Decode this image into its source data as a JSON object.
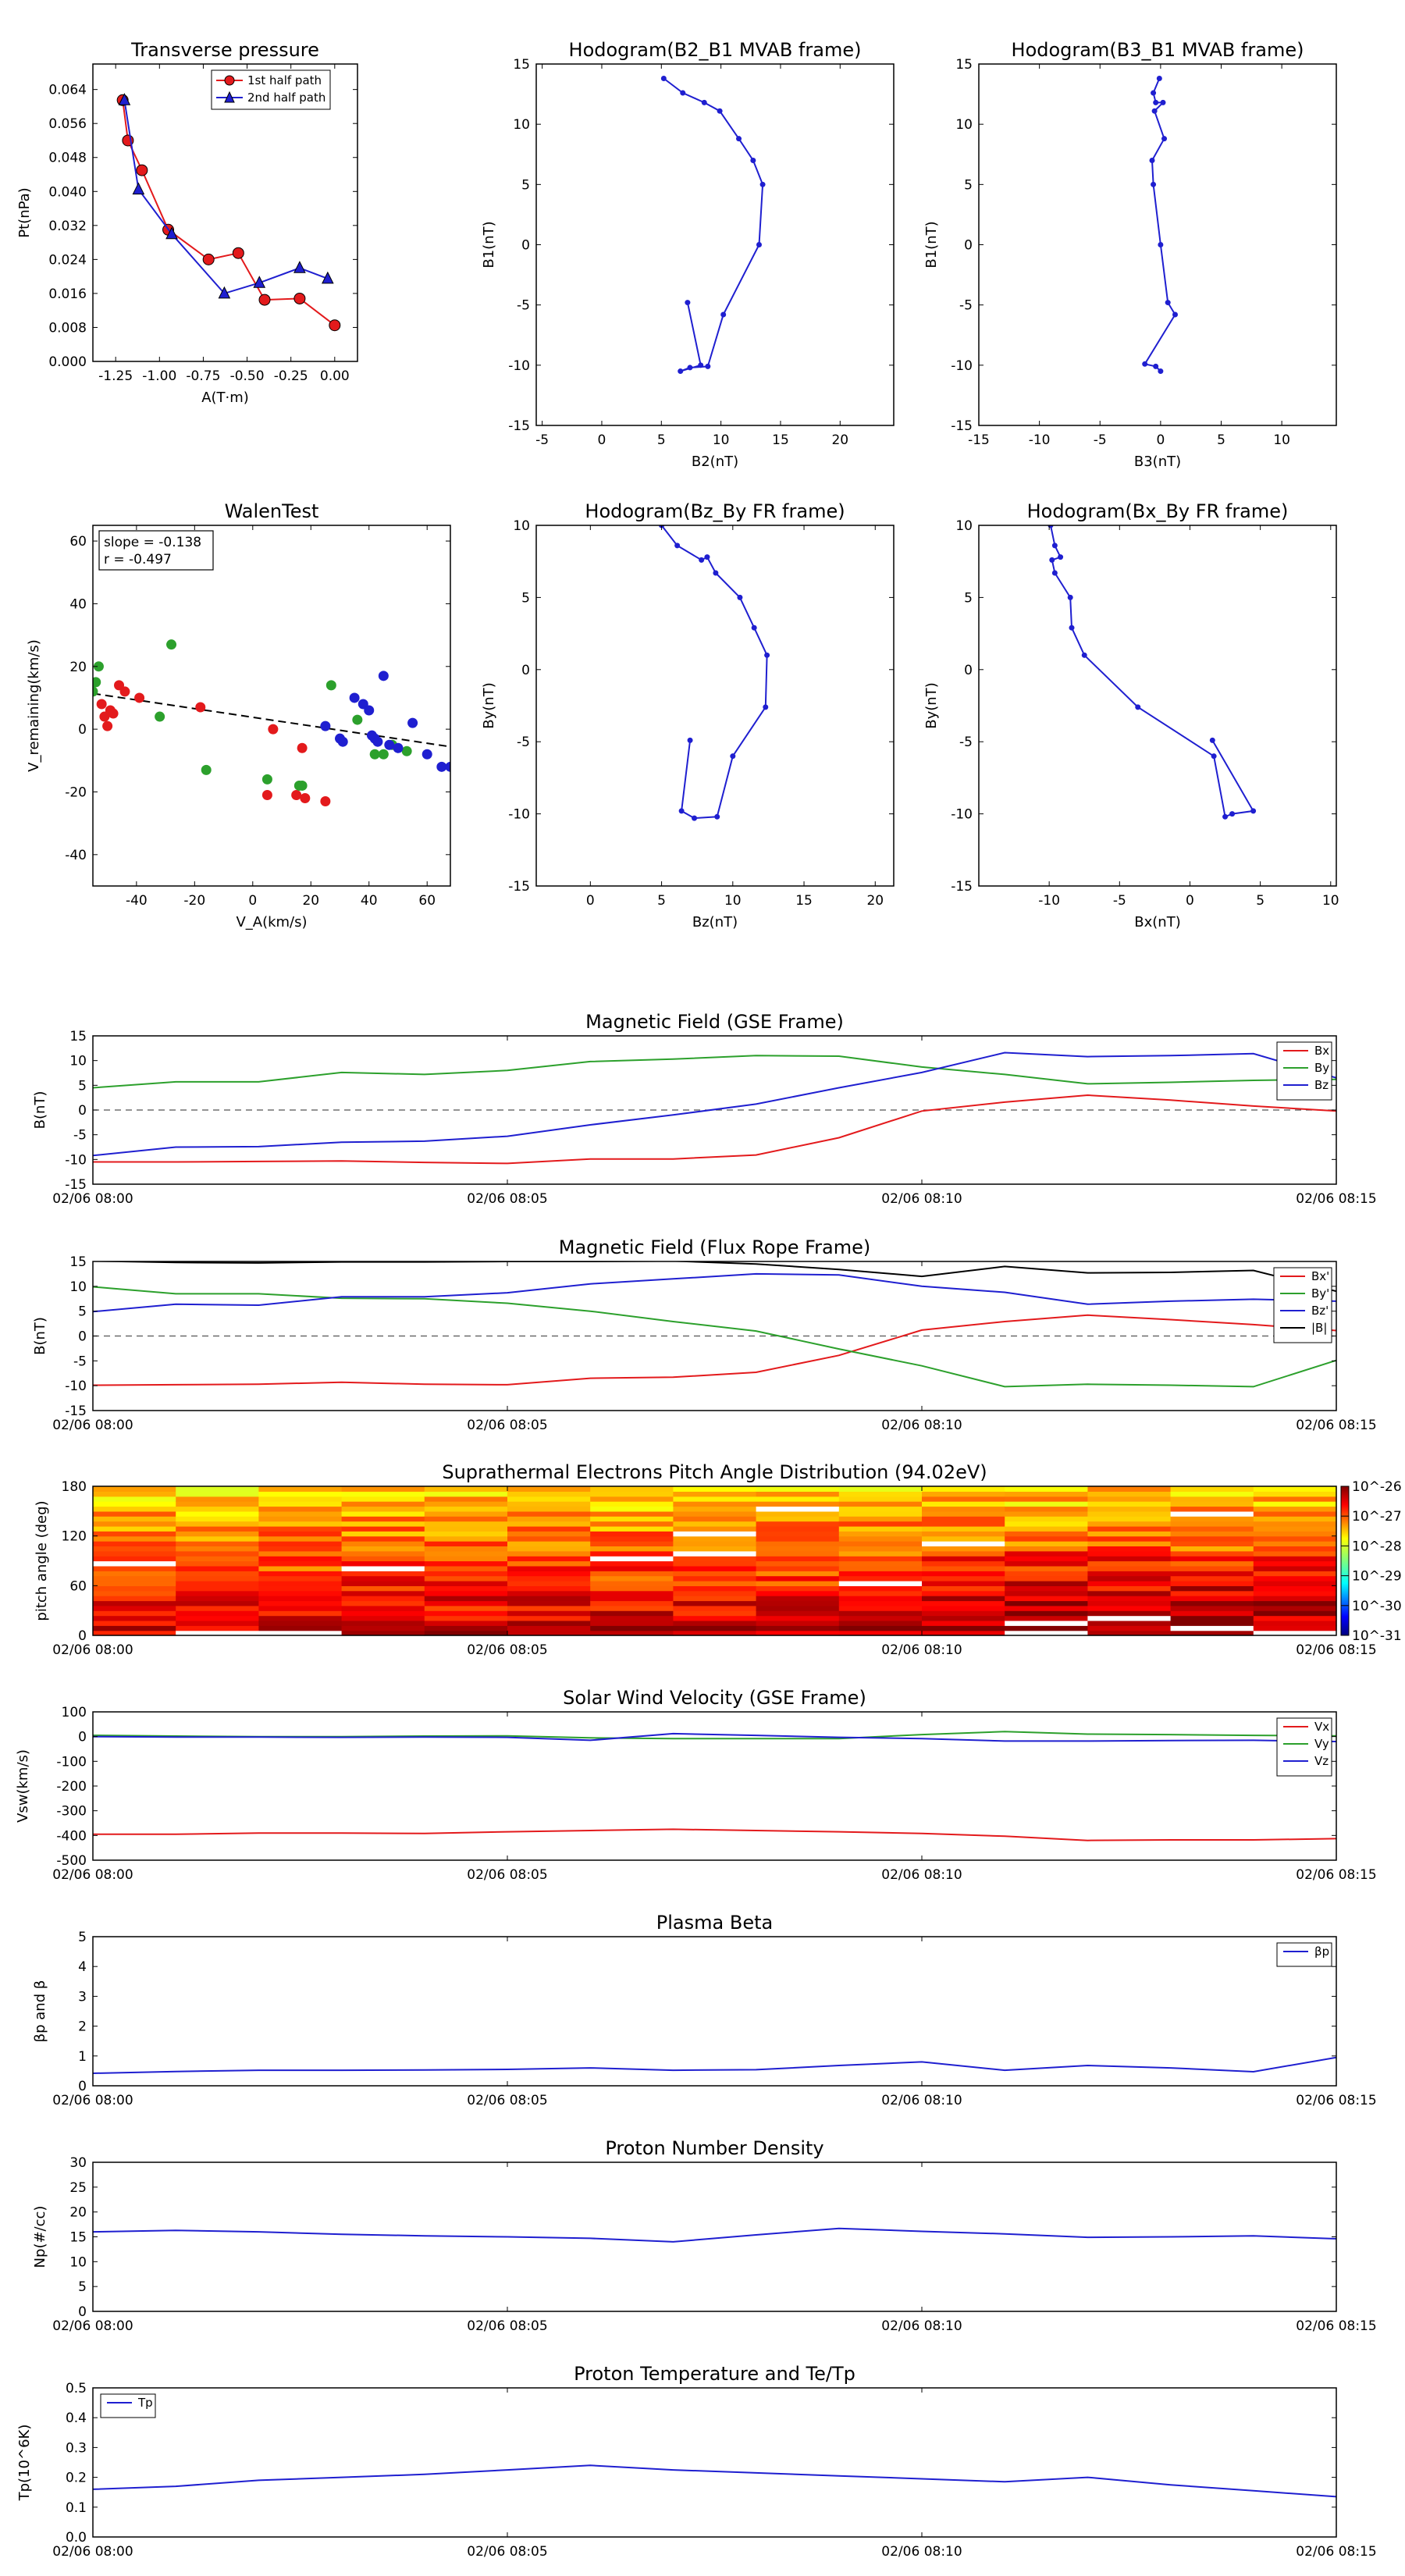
{
  "chart_data": [
    {
      "id": "transverse",
      "type": "line",
      "title": "Transverse pressure",
      "xlabel": "A(T·m)",
      "ylabel": "Pt(nPa)",
      "xlim": [
        -1.38,
        0.13
      ],
      "ylim": [
        0,
        0.07
      ],
      "xticks": [
        -1.25,
        -1.0,
        -0.75,
        -0.5,
        -0.25,
        0.0
      ],
      "xtick_labels": [
        "-1.25",
        "-1.00",
        "-0.75",
        "-0.50",
        "-0.25",
        "0.00"
      ],
      "yticks": [
        0,
        0.008,
        0.016,
        0.024,
        0.032,
        0.04,
        0.048,
        0.056,
        0.064
      ],
      "ytick_labels": [
        "0.000",
        "0.008",
        "0.016",
        "0.024",
        "0.032",
        "0.040",
        "0.048",
        "0.056",
        "0.064"
      ],
      "legend_position": "top-center",
      "series": [
        {
          "name": "1st half path",
          "color": "#e31a1c",
          "marker": "circle",
          "x": [
            -1.21,
            -1.18,
            -1.1,
            -0.95,
            -0.72,
            -0.55,
            -0.4,
            -0.2,
            0.0
          ],
          "y": [
            0.0615,
            0.052,
            0.045,
            0.031,
            0.024,
            0.0255,
            0.0145,
            0.0148,
            0.0085
          ]
        },
        {
          "name": "2nd half path",
          "color": "#1f1fd0",
          "marker": "triangle",
          "x": [
            -1.2,
            -1.12,
            -0.93,
            -0.63,
            -0.43,
            -0.2,
            -0.04
          ],
          "y": [
            0.0615,
            0.0405,
            0.03,
            0.016,
            0.0185,
            0.022,
            0.0195
          ]
        }
      ]
    },
    {
      "id": "hodo_b2b1",
      "type": "line",
      "title": "Hodogram(B2_B1 MVAB frame)",
      "xlabel": "B2(nT)",
      "ylabel": "B1(nT)",
      "xlim": [
        -5.5,
        24.5
      ],
      "ylim": [
        -15,
        15
      ],
      "xticks": [
        -5,
        0,
        5,
        10,
        15,
        20
      ],
      "yticks": [
        -15,
        -10,
        -5,
        0,
        5,
        10,
        15
      ],
      "series": [
        {
          "name": "",
          "color": "#1f1fd0",
          "x": [
            5.2,
            6.8,
            8.6,
            9.9,
            11.5,
            12.7,
            13.5,
            13.2,
            10.2,
            8.9,
            7.4,
            6.6,
            8.3,
            7.2
          ],
          "y": [
            13.8,
            12.6,
            11.8,
            11.1,
            8.8,
            7.0,
            5.0,
            0.0,
            -5.8,
            -10.1,
            -10.2,
            -10.5,
            -10.0,
            -4.8
          ]
        }
      ]
    },
    {
      "id": "hodo_b3b1",
      "type": "line",
      "title": "Hodogram(B3_B1 MVAB frame)",
      "xlabel": "B3(nT)",
      "ylabel": "B1(nT)",
      "xlim": [
        -15,
        14.5
      ],
      "ylim": [
        -15,
        15
      ],
      "xticks": [
        -15,
        -10,
        -5,
        0,
        5,
        10
      ],
      "yticks": [
        -15,
        -10,
        -5,
        0,
        5,
        10,
        15
      ],
      "series": [
        {
          "name": "",
          "color": "#1f1fd0",
          "x": [
            -0.1,
            -0.6,
            -0.4,
            0.2,
            -0.5,
            0.3,
            -0.7,
            -0.6,
            0.0,
            0.6,
            1.2,
            -1.3,
            -0.4,
            0.0
          ],
          "y": [
            13.8,
            12.6,
            11.8,
            11.8,
            11.1,
            8.8,
            7.0,
            5.0,
            0.0,
            -4.8,
            -5.8,
            -9.9,
            -10.1,
            -10.5
          ]
        }
      ]
    },
    {
      "id": "walen",
      "type": "scatter",
      "title": "WalenTest",
      "xlabel": "V_A(km/s)",
      "ylabel": "V_remaining(km/s)",
      "xlim": [
        -55,
        68
      ],
      "ylim": [
        -50,
        65
      ],
      "xticks": [
        -40,
        -20,
        0,
        20,
        40,
        60
      ],
      "yticks": [
        -40,
        -20,
        0,
        20,
        40,
        60
      ],
      "annotations": [
        "slope = -0.138",
        "r = -0.497"
      ],
      "fit_line": {
        "slope": -0.138,
        "intercept": 3.8,
        "x_range": [
          -55,
          68
        ],
        "color": "#000000"
      },
      "series": [
        {
          "name": "",
          "color": "#e31a1c",
          "x": [
            -52,
            -51,
            -50,
            -49,
            -48,
            -46,
            -44,
            -39,
            -18,
            7,
            5,
            15,
            17,
            18,
            25
          ],
          "y": [
            8,
            4,
            1,
            6,
            5,
            14,
            12,
            10,
            7,
            0,
            -21,
            -21,
            -6,
            -22,
            -23
          ]
        },
        {
          "name": "",
          "color": "#2ca02c",
          "x": [
            -55,
            -54,
            -53,
            -32,
            -28,
            -16,
            5,
            16,
            17,
            27,
            36,
            42,
            45,
            48,
            53
          ],
          "y": [
            12,
            15,
            20,
            4,
            27,
            -13,
            -16,
            -18,
            -18,
            14,
            3,
            -8,
            -8,
            -5,
            -7
          ]
        },
        {
          "name": "",
          "color": "#1f1fd0",
          "x": [
            25,
            30,
            31,
            35,
            38,
            40,
            41,
            42,
            43,
            45,
            47,
            50,
            55,
            60,
            65,
            68
          ],
          "y": [
            1,
            -3,
            -4,
            10,
            8,
            6,
            -2,
            -3,
            -4,
            17,
            -5,
            -6,
            2,
            -8,
            -12,
            -12
          ]
        }
      ]
    },
    {
      "id": "hodo_bzby",
      "type": "line",
      "title": "Hodogram(Bz_By FR frame)",
      "xlabel": "Bz(nT)",
      "ylabel": "By(nT)",
      "xlim": [
        -3.8,
        21.3
      ],
      "ylim": [
        -15,
        10
      ],
      "xticks": [
        0,
        5,
        10,
        15,
        20
      ],
      "yticks": [
        -15,
        -10,
        -5,
        0,
        5,
        10
      ],
      "series": [
        {
          "name": "",
          "color": "#1f1fd0",
          "x": [
            5.0,
            6.1,
            7.8,
            8.2,
            8.8,
            10.5,
            11.5,
            12.4,
            12.3,
            10.0,
            8.9,
            7.3,
            6.4,
            7.0
          ],
          "y": [
            10.0,
            8.6,
            7.6,
            7.8,
            6.7,
            5.0,
            2.9,
            1.0,
            -2.6,
            -6.0,
            -10.2,
            -10.3,
            -9.8,
            -4.9
          ]
        }
      ]
    },
    {
      "id": "hodo_bxby",
      "type": "line",
      "title": "Hodogram(Bx_By FR frame)",
      "xlabel": "Bx(nT)",
      "ylabel": "By(nT)",
      "xlim": [
        -15,
        10.4
      ],
      "ylim": [
        -15,
        10
      ],
      "xticks": [
        -10,
        -5,
        0,
        5,
        10
      ],
      "yticks": [
        -15,
        -10,
        -5,
        0,
        5,
        10
      ],
      "series": [
        {
          "name": "",
          "color": "#1f1fd0",
          "x": [
            -9.9,
            -9.6,
            -9.2,
            -9.8,
            -9.6,
            -8.5,
            -8.4,
            -7.5,
            -3.7,
            1.7,
            2.5,
            3.0,
            4.5,
            1.6
          ],
          "y": [
            10.0,
            8.6,
            7.8,
            7.6,
            6.7,
            5.0,
            2.9,
            1.0,
            -2.6,
            -6.0,
            -10.2,
            -10.0,
            -9.8,
            -4.9
          ]
        }
      ]
    },
    {
      "id": "mag_gse",
      "type": "line",
      "title": "Magnetic Field (GSE Frame)",
      "ylabel": "B(nT)",
      "xlim": [
        0,
        15
      ],
      "x_unit": "minutes after 02/06 08:00",
      "ylim": [
        -15,
        15
      ],
      "yticks": [
        -15,
        -10,
        -5,
        0,
        5,
        10,
        15
      ],
      "xtick_labels": [
        "02/06 08:00",
        "02/06 08:05",
        "02/06 08:10",
        "02/06 08:15"
      ],
      "legend_position": "top-right",
      "zero_line": true,
      "x": [
        0,
        1,
        2,
        3,
        4,
        5,
        6,
        7,
        8,
        9,
        10,
        11,
        12,
        13,
        14,
        15
      ],
      "series": [
        {
          "name": "Bx",
          "color": "#e31a1c",
          "values": [
            -10.5,
            -10.5,
            -10.4,
            -10.3,
            -10.6,
            -10.8,
            -9.9,
            -9.9,
            -9.1,
            -5.6,
            -0.2,
            1.6,
            3.0,
            2.0,
            0.8,
            -0.2
          ]
        },
        {
          "name": "By",
          "color": "#2ca02c",
          "values": [
            4.5,
            5.7,
            5.7,
            7.6,
            7.2,
            8.0,
            9.8,
            10.3,
            11.0,
            10.9,
            8.7,
            7.2,
            5.3,
            5.6,
            6.0,
            6.2
          ]
        },
        {
          "name": "Bz",
          "color": "#1f1fd0",
          "values": [
            -9.2,
            -7.5,
            -7.4,
            -6.5,
            -6.3,
            -5.3,
            -3.0,
            -1.0,
            1.2,
            4.5,
            7.6,
            11.6,
            10.8,
            11.0,
            11.4,
            6.5
          ]
        }
      ]
    },
    {
      "id": "mag_fr",
      "type": "line",
      "title": "Magnetic Field (Flux Rope Frame)",
      "ylabel": "B(nT)",
      "xlim": [
        0,
        15
      ],
      "x_unit": "minutes after 02/06 08:00",
      "ylim": [
        -15,
        15
      ],
      "yticks": [
        -15,
        -10,
        -5,
        0,
        5,
        10,
        15
      ],
      "xtick_labels": [
        "02/06 08:00",
        "02/06 08:05",
        "02/06 08:10",
        "02/06 08:15"
      ],
      "legend_position": "top-right",
      "zero_line": true,
      "x": [
        0,
        1,
        2,
        3,
        4,
        5,
        6,
        7,
        8,
        9,
        10,
        11,
        12,
        13,
        14,
        15
      ],
      "series": [
        {
          "name": "Bx'",
          "color": "#e31a1c",
          "values": [
            -9.9,
            -9.8,
            -9.7,
            -9.3,
            -9.7,
            -9.8,
            -8.5,
            -8.3,
            -7.3,
            -3.9,
            1.2,
            2.9,
            4.2,
            3.3,
            2.3,
            1.1
          ]
        },
        {
          "name": "By'",
          "color": "#2ca02c",
          "values": [
            9.9,
            8.5,
            8.5,
            7.6,
            7.5,
            6.6,
            5.0,
            2.9,
            1.0,
            -2.6,
            -6.0,
            -10.2,
            -9.7,
            -9.9,
            -10.2,
            -4.9
          ]
        },
        {
          "name": "Bz'",
          "color": "#1f1fd0",
          "values": [
            4.9,
            6.4,
            6.2,
            7.9,
            7.9,
            8.7,
            10.5,
            11.5,
            12.5,
            12.3,
            10.0,
            8.8,
            6.4,
            7.0,
            7.4,
            7.0
          ]
        },
        {
          "name": "|B|",
          "color": "#000000",
          "values": [
            15.1,
            14.8,
            14.7,
            14.9,
            14.9,
            15.0,
            15.0,
            15.1,
            14.5,
            13.4,
            12.0,
            14.0,
            12.7,
            12.8,
            13.2,
            9.0
          ]
        }
      ]
    },
    {
      "id": "pad",
      "type": "heatmap",
      "title": "Suprathermal Electrons Pitch Angle Distribution (94.02eV)",
      "ylabel": "pitch angle (deg)",
      "xlim": [
        0,
        15
      ],
      "ylim": [
        0,
        180
      ],
      "yticks": [
        0,
        60,
        120,
        180
      ],
      "xtick_labels": [
        "02/06 08:00",
        "02/06 08:05",
        "02/06 08:10",
        "02/06 08:15"
      ],
      "colorbar_labels": [
        "10^-26",
        "10^-27",
        "10^-28",
        "10^-29",
        "10^-30",
        "10^-31"
      ],
      "n_time_bins": 15,
      "n_angle_bins": 30,
      "log_flux_range": [
        -31,
        -26
      ]
    },
    {
      "id": "vsw",
      "type": "line",
      "title": "Solar Wind Velocity (GSE Frame)",
      "ylabel": "Vsw(km/s)",
      "xlim": [
        0,
        15
      ],
      "x_unit": "minutes after 02/06 08:00",
      "ylim": [
        -500,
        100
      ],
      "yticks": [
        -500,
        -400,
        -300,
        -200,
        -100,
        0,
        100
      ],
      "xtick_labels": [
        "02/06 08:00",
        "02/06 08:05",
        "02/06 08:10",
        "02/06 08:15"
      ],
      "legend_position": "top-right",
      "x": [
        0,
        1,
        2,
        3,
        4,
        5,
        6,
        7,
        8,
        9,
        10,
        11,
        12,
        13,
        14,
        15
      ],
      "series": [
        {
          "name": "Vx",
          "color": "#e31a1c",
          "values": [
            -395,
            -395,
            -390,
            -390,
            -392,
            -385,
            -380,
            -375,
            -380,
            -385,
            -392,
            -403,
            -420,
            -418,
            -418,
            -413
          ]
        },
        {
          "name": "Vy",
          "color": "#2ca02c",
          "values": [
            5,
            2,
            0,
            0,
            2,
            3,
            -5,
            -8,
            -8,
            -8,
            8,
            20,
            10,
            8,
            5,
            3
          ]
        },
        {
          "name": "Vz",
          "color": "#1f1fd0",
          "values": [
            0,
            -2,
            -2,
            -3,
            -2,
            -3,
            -15,
            12,
            5,
            -3,
            -8,
            -18,
            -18,
            -16,
            -15,
            -20
          ]
        }
      ]
    },
    {
      "id": "beta",
      "type": "line",
      "title": "Plasma Beta",
      "ylabel": "βp and β",
      "xlim": [
        0,
        15
      ],
      "x_unit": "minutes after 02/06 08:00",
      "ylim": [
        0,
        5
      ],
      "yticks": [
        0,
        1,
        2,
        3,
        4,
        5
      ],
      "xtick_labels": [
        "02/06 08:00",
        "02/06 08:05",
        "02/06 08:10",
        "02/06 08:15"
      ],
      "legend_position": "top-right",
      "x": [
        0,
        1,
        2,
        3,
        4,
        5,
        6,
        7,
        8,
        9,
        10,
        11,
        12,
        13,
        14,
        15
      ],
      "series": [
        {
          "name": "βp",
          "color": "#1f1fd0",
          "values": [
            0.42,
            0.48,
            0.52,
            0.52,
            0.53,
            0.55,
            0.6,
            0.52,
            0.54,
            0.68,
            0.8,
            0.52,
            0.68,
            0.6,
            0.47,
            0.95
          ]
        }
      ]
    },
    {
      "id": "density",
      "type": "line",
      "title": "Proton Number Density",
      "ylabel": "Np(#/cc)",
      "xlim": [
        0,
        15
      ],
      "x_unit": "minutes after 02/06 08:00",
      "ylim": [
        0,
        30
      ],
      "yticks": [
        0,
        5,
        10,
        15,
        20,
        25,
        30
      ],
      "xtick_labels": [
        "02/06 08:00",
        "02/06 08:05",
        "02/06 08:10",
        "02/06 08:15"
      ],
      "x": [
        0,
        1,
        2,
        3,
        4,
        5,
        6,
        7,
        8,
        9,
        10,
        11,
        12,
        13,
        14,
        15
      ],
      "series": [
        {
          "name": "",
          "color": "#1f1fd0",
          "values": [
            16.0,
            16.3,
            16.0,
            15.5,
            15.2,
            15.0,
            14.7,
            14.0,
            15.4,
            16.7,
            16.1,
            15.6,
            14.9,
            15.0,
            15.2,
            14.6
          ]
        }
      ]
    },
    {
      "id": "temperature",
      "type": "line",
      "title": "Proton Temperature and Te/Tp",
      "ylabel": "Tp(10^6K)",
      "xlim": [
        0,
        15
      ],
      "x_unit": "minutes after 02/06 08:00",
      "ylim": [
        0,
        0.5
      ],
      "yticks": [
        0,
        0.1,
        0.2,
        0.3,
        0.4,
        0.5
      ],
      "ytick_labels": [
        "0.0",
        "0.1",
        "0.2",
        "0.3",
        "0.4",
        "0.5"
      ],
      "xtick_labels": [
        "02/06 08:00",
        "02/06 08:05",
        "02/06 08:10",
        "02/06 08:15"
      ],
      "legend_position": "top-left",
      "x": [
        0,
        1,
        2,
        3,
        4,
        5,
        6,
        7,
        8,
        9,
        10,
        11,
        12,
        13,
        14,
        15
      ],
      "series": [
        {
          "name": "Tp",
          "color": "#1f1fd0",
          "values": [
            0.16,
            0.17,
            0.19,
            0.2,
            0.21,
            0.225,
            0.24,
            0.225,
            0.215,
            0.205,
            0.195,
            0.185,
            0.2,
            0.175,
            0.155,
            0.135
          ]
        }
      ]
    }
  ]
}
